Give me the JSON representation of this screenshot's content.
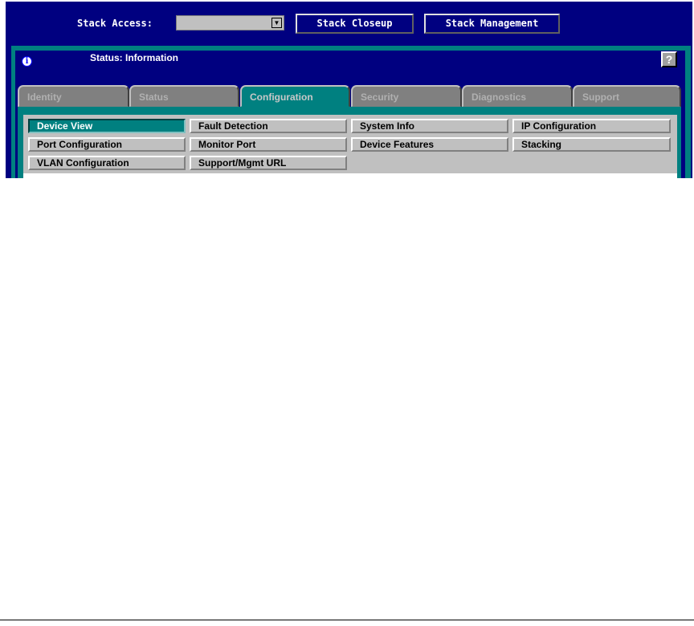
{
  "toolbar": {
    "stack_access_label": "Stack Access:",
    "stack_access_value": "",
    "stack_closeup": "Stack Closeup",
    "stack_management": "Stack Management"
  },
  "status": {
    "text": "Status: Information",
    "help": "?",
    "info": "i"
  },
  "tabs": [
    "Identity",
    "Status",
    "Configuration",
    "Security",
    "Diagnostics",
    "Support"
  ],
  "active_tab": "Configuration",
  "config_buttons": [
    "Device View",
    "Fault Detection",
    "System Info",
    "IP Configuration",
    "Port Configuration",
    "Monitor Port",
    "Device Features",
    "Stacking",
    "VLAN Configuration",
    "Support/Mgmt URL"
  ],
  "colors": {
    "navy": "#000080",
    "teal": "#008080",
    "gray": "#c0c0c0"
  }
}
